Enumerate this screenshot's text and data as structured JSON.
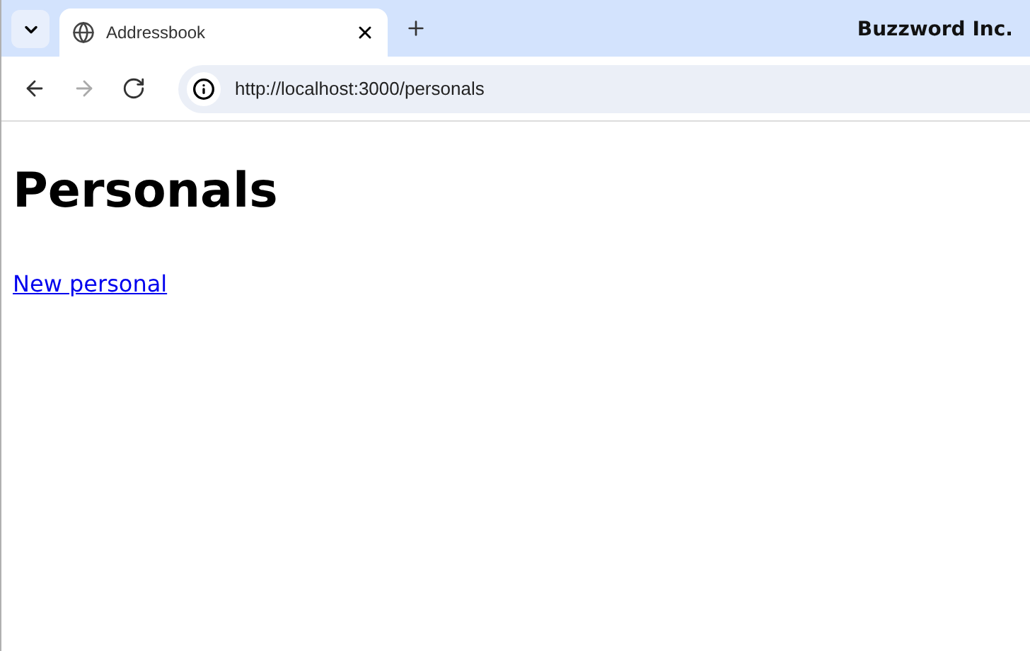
{
  "browser": {
    "tabs": [
      {
        "title": "Addressbook",
        "selected": true
      }
    ],
    "profile": "Buzzword Inc.",
    "nav_buttons": [
      {
        "kind": "back",
        "disabled": false
      },
      {
        "kind": "forward",
        "disabled": true
      },
      {
        "kind": "reload",
        "disabled": false
      }
    ],
    "address": "http://localhost:3000/personals"
  },
  "page": {
    "heading": "Personals",
    "link": "New personal"
  }
}
